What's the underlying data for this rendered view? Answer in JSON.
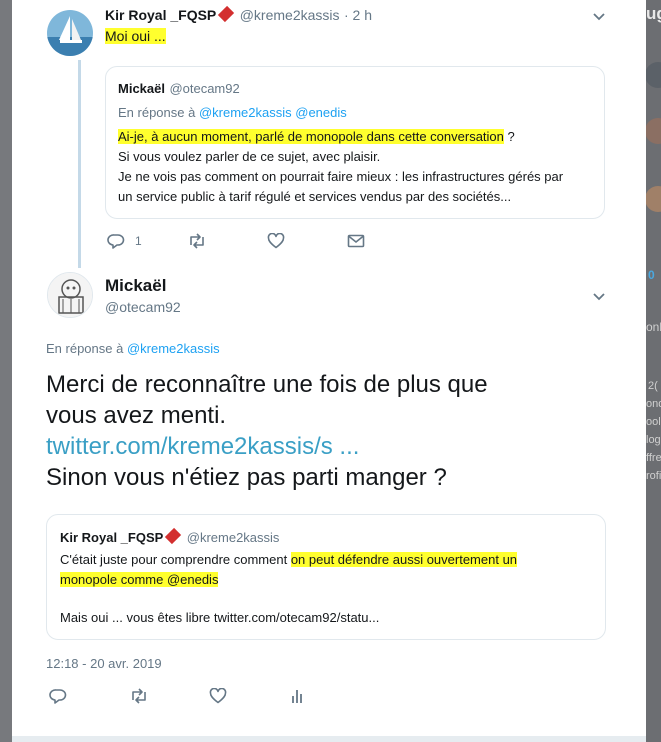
{
  "tweet1": {
    "name": "Kir Royal _FQSP",
    "handle": "@kreme2kassis",
    "time": "· 2 h",
    "text": "Moi oui ...",
    "quote": {
      "name": "Mickaël",
      "handle": "@otecam92",
      "reply_prefix": "En réponse à",
      "reply_users": "@kreme2kassis @enedis",
      "line1_highlight": "Ai-je, à aucun moment, parlé de monopole dans cette conversation",
      "line1_tail": " ?",
      "line2": "Si vous voulez parler de ce sujet, avec plaisir.",
      "line3": "Je ne vois pas comment on pourrait faire mieux : les infrastructures gérés par",
      "line4": "un service public à tarif régulé et services vendus par des sociétés..."
    },
    "actions": {
      "reply_count": "1"
    }
  },
  "tweet2": {
    "name": "Mickaël",
    "handle": "@otecam92",
    "reply_prefix": "En réponse à",
    "reply_user": "@kreme2kassis",
    "line1": "Merci de reconnaître une fois de plus que",
    "line2": "vous avez menti.",
    "link": "twitter.com/kreme2kassis/s ...",
    "line3": "Sinon vous n'étiez pas parti manger ?",
    "quote": {
      "name": "Kir Royal _FQSP",
      "handle": "@kreme2kassis",
      "line1_plain": "C'était juste pour comprendre comment ",
      "line1_highlight": "on peut défendre aussi ouvertement un",
      "line2_highlight": "monopole comme @enedis",
      "line3": "Mais oui ... vous êtes libre twitter.com/otecam92/statu..."
    },
    "timestamp": "12:18 - 20 avr. 2019"
  },
  "right_panel": {
    "t1": "ug",
    "t2": "0",
    "t3": "onl",
    "t4": "2(",
    "t5": "ond",
    "t6": "ool",
    "t7": "log",
    "t8": "ffre",
    "t9": "rofi"
  },
  "colors": {
    "highlight": "#ffff2e",
    "link": "#1da1f2",
    "muted": "#657786",
    "thread_line": "#c4d9e8"
  }
}
